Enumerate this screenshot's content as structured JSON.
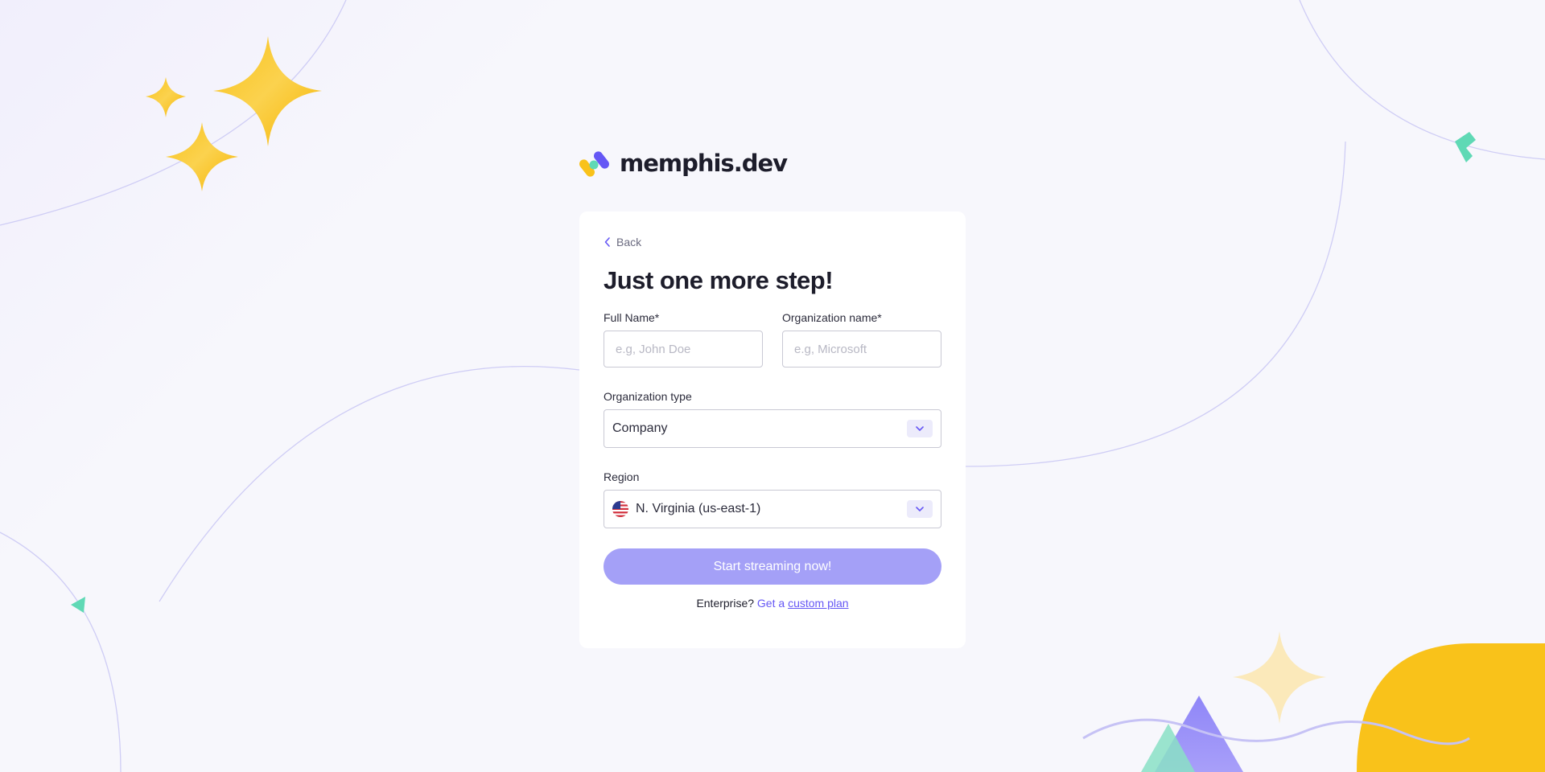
{
  "brand": {
    "name": "memphis.dev",
    "logo_icon": "memphis-logo-icon"
  },
  "form": {
    "back_label": "Back",
    "title": "Just one more step!",
    "full_name": {
      "label": "Full Name*",
      "placeholder": "e.g, John Doe",
      "value": ""
    },
    "org_name": {
      "label": "Organization name*",
      "placeholder": "e.g, Microsoft",
      "value": ""
    },
    "org_type": {
      "label": "Organization type",
      "selected": "Company"
    },
    "region": {
      "label": "Region",
      "selected": "N. Virginia (us-east-1)",
      "flag_icon": "us-flag-icon"
    },
    "submit_label": "Start streaming now!",
    "enterprise": {
      "prefix": "Enterprise?",
      "get_a": "Get a",
      "link": "custom plan"
    }
  },
  "colors": {
    "accent": "#6557f5",
    "button": "#a4a0f7",
    "star": "#f9c21a",
    "teal": "#5fd9b5"
  }
}
